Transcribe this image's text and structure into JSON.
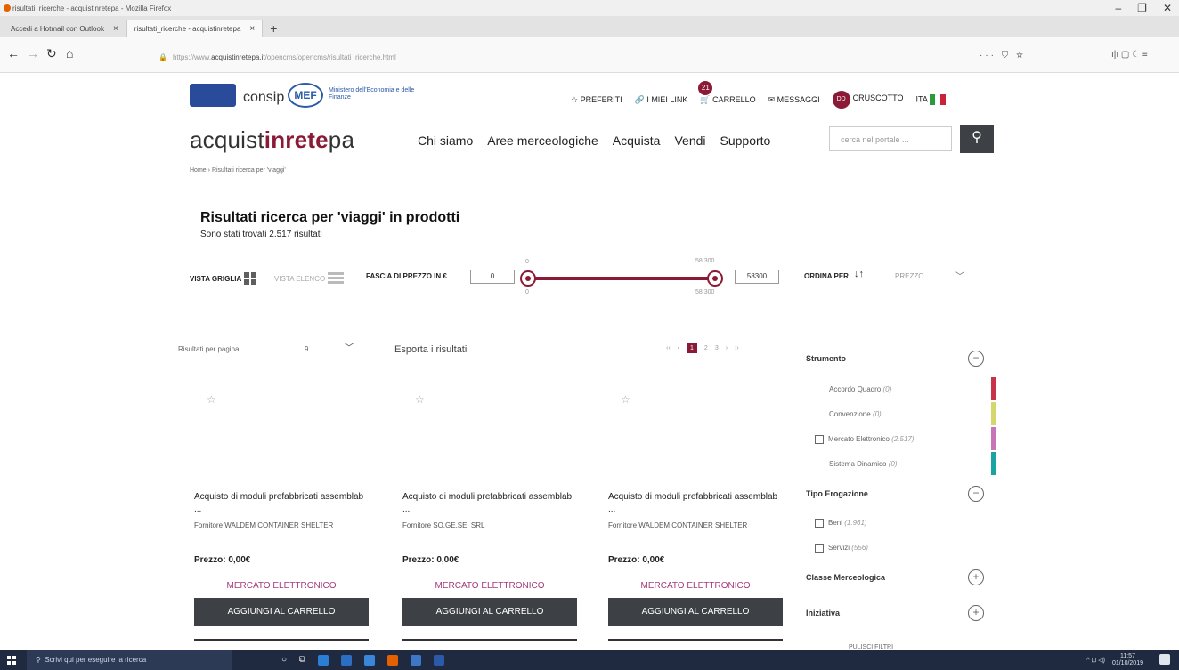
{
  "browser": {
    "window_title": "risultati_ricerche - acquistinretepa - Mozilla Firefox",
    "tabs": [
      {
        "label": "Accedi a Hotmail con Outlook",
        "close": "×"
      },
      {
        "label": "risultati_ricerche - acquistinretepa",
        "close": "×"
      }
    ],
    "new_tab": "+",
    "url_prefix": "https://www.",
    "url_host": "acquistinretepa.it",
    "url_path": "/opencms/opencms/risultati_ricerche.html",
    "url_actions": "··· ⛉ ☆",
    "right_tools": "ı|ı ▢ ☾ ≡"
  },
  "header": {
    "consip": "consip",
    "mef": "MEF",
    "mef_sub": "Ministero dell'Economia e delle Finanze",
    "preferiti": "PREFERITI",
    "imiei": "I MIEI LINK",
    "cart_count": "21",
    "carrello": "CARRELLO",
    "messaggi": "MESSAGGI",
    "user_initials": "DD",
    "cruscotto": "CRUSCOTTO",
    "lang": "ITA"
  },
  "brand": {
    "pre": "acquist",
    "mid": "inrete",
    "post": "pa"
  },
  "nav": [
    "Chi siamo",
    "Aree merceologiche",
    "Acquista",
    "Vendi",
    "Supporto"
  ],
  "search": {
    "placeholder": "cerca nel portale ..."
  },
  "breadcrumb": {
    "home": "Home",
    "sep": "›",
    "current": "Risultati ricerca per 'viaggi'"
  },
  "results": {
    "title": "Risultati ricerca per 'viaggi' in prodotti",
    "subtitle": "Sono stati trovati 2.517 risultati"
  },
  "filters": {
    "vista_griglia": "VISTA GRIGLIA",
    "vista_elenco": "VISTA ELENCO",
    "fascia": "FASCIA DI PREZZO IN €",
    "min": "0",
    "max": "58300",
    "min_top": "0",
    "max_top": "58.300",
    "min_bottom": "0",
    "max_bottom": "58.300",
    "ordina": "ORDINA PER",
    "ordina_val": "PREZZO"
  },
  "paging": {
    "rpp_label": "Risultati per pagina",
    "rpp_value": "9",
    "export": "Esporta i risultati",
    "prev2": "‹‹",
    "prev": "‹",
    "pages": [
      "1",
      "2",
      "3"
    ],
    "next": "›",
    "next2": "››"
  },
  "products": [
    {
      "title": "Acquisto di moduli prefabbricati assemblab ...",
      "supplier": "Fornitore WALDEM CONTAINER SHELTER",
      "price": "Prezzo: 0,00€",
      "market": "MERCATO ELETTRONICO",
      "button": "AGGIUNGI AL CARRELLO"
    },
    {
      "title": "Acquisto di moduli prefabbricati assemblab ...",
      "supplier": "Fornitore SO.GE.SE. SRL",
      "price": "Prezzo: 0,00€",
      "market": "MERCATO ELETTRONICO",
      "button": "AGGIUNGI AL CARRELLO"
    },
    {
      "title": "Acquisto di moduli prefabbricati assemblab ...",
      "supplier": "Fornitore WALDEM CONTAINER SHELTER",
      "price": "Prezzo: 0,00€",
      "market": "MERCATO ELETTRONICO",
      "button": "AGGIUNGI AL CARRELLO"
    }
  ],
  "sidebar": {
    "strumento": "Strumento",
    "items": [
      {
        "label": "Accordo Quadro",
        "count": "(0)",
        "color": "#c8334a"
      },
      {
        "label": "Convenzione",
        "count": "(0)",
        "color": "#d4d86a"
      },
      {
        "label": "Mercato Elettronico",
        "count": "(2.517)",
        "color": "#c774b8"
      },
      {
        "label": "Sistema Dinamico",
        "count": "(0)",
        "color": "#1aa3a3"
      }
    ],
    "tipo": "Tipo Erogazione",
    "tipo_items": [
      {
        "label": "Beni",
        "count": "(1.961)"
      },
      {
        "label": "Servizi",
        "count": "(556)"
      }
    ],
    "classe": "Classe Merceologica",
    "iniziativa": "Iniziativa",
    "reset": "PULISCI FILTRI",
    "minus": "−",
    "plus": "+"
  },
  "taskbar": {
    "search": "Scrivi qui per eseguire la ricerca",
    "time": "11:57",
    "date": "01/10/2019"
  },
  "colors": {
    "accent": "#8a1a35",
    "dark_button": "#3d4045"
  }
}
